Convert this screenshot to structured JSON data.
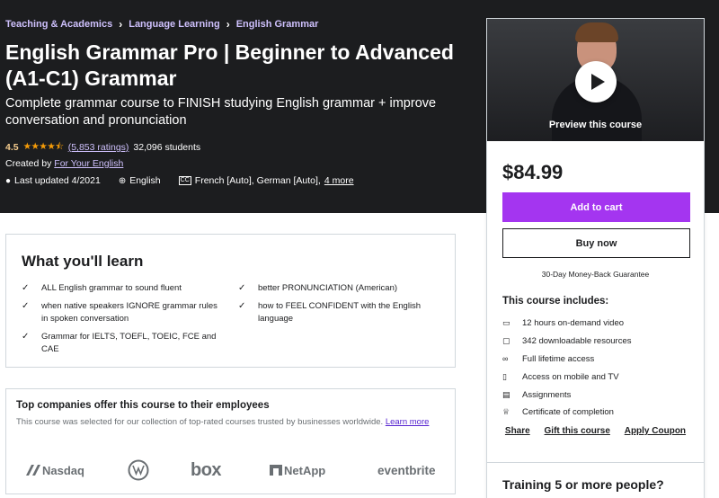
{
  "breadcrumb": [
    "Teaching & Academics",
    "Language Learning",
    "English Grammar"
  ],
  "course": {
    "title": "English Grammar Pro | Beginner to Advanced (A1-C1) Grammar",
    "subtitle": "Complete grammar course to FINISH studying English grammar + improve conversation and pronunciation",
    "rating": "4.5",
    "stars": "★★★★⯪",
    "ratings_count": "(5,853 ratings)",
    "students": "32,096 students",
    "created_by_label": "Created by",
    "instructor": "For Your English",
    "last_updated": "Last updated 4/2021",
    "language": "English",
    "captions": "French [Auto], German [Auto],",
    "captions_more": "4 more"
  },
  "card": {
    "preview_label": "Preview this course",
    "price": "$84.99",
    "add_to_cart": "Add to cart",
    "buy_now": "Buy now",
    "guarantee": "30-Day Money-Back Guarantee",
    "includes_heading": "This course includes:",
    "includes": [
      {
        "icon": "video-icon",
        "glyph": "▭",
        "text": "12 hours on-demand video"
      },
      {
        "icon": "file-icon",
        "glyph": "▢",
        "text": "342 downloadable resources"
      },
      {
        "icon": "infinity-icon",
        "glyph": "∞",
        "text": "Full lifetime access"
      },
      {
        "icon": "mobile-icon",
        "glyph": "▯",
        "text": "Access on mobile and TV"
      },
      {
        "icon": "assignment-icon",
        "glyph": "▤",
        "text": "Assignments"
      },
      {
        "icon": "trophy-icon",
        "glyph": "♕",
        "text": "Certificate of completion"
      }
    ],
    "links": [
      "Share",
      "Gift this course",
      "Apply Coupon"
    ],
    "training": "Training 5 or more people?"
  },
  "learn": {
    "heading": "What you'll learn",
    "left": [
      "ALL English grammar to sound fluent",
      "when native speakers IGNORE grammar rules in spoken conversation",
      "Grammar for IELTS, TOEFL, TOEIC, FCE and CAE"
    ],
    "right": [
      "better PRONUNCIATION (American)",
      "how to FEEL CONFIDENT with the English language"
    ]
  },
  "companies": {
    "heading": "Top companies offer this course to their employees",
    "text": "This course was selected for our collection of top-rated courses trusted by businesses worldwide.",
    "learn_more": "Learn more",
    "logos": [
      "Nasdaq",
      "box",
      "NetApp",
      "eventbrite"
    ]
  },
  "colors": {
    "hero_bg": "#1c1d1f",
    "accent_purple": "#a435f0",
    "link_purple": "#cec0fc",
    "star_orange": "#f69c08"
  }
}
